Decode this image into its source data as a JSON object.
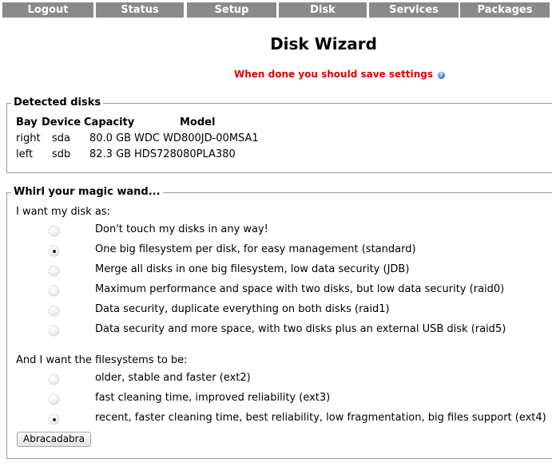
{
  "nav": {
    "items": [
      {
        "label": "Logout"
      },
      {
        "label": "Status"
      },
      {
        "label": "Setup"
      },
      {
        "label": "Disk"
      },
      {
        "label": "Services"
      },
      {
        "label": "Packages"
      }
    ],
    "bg_color": "#8a8a8a"
  },
  "page": {
    "title": "Disk Wizard",
    "save_note": "When done you should save settings",
    "save_note_color": "#e00000",
    "help_icon": "help-icon"
  },
  "detected": {
    "legend": "Detected disks",
    "headers": {
      "bay": "Bay",
      "device": "Device",
      "capacity": "Capacity",
      "model": "Model"
    },
    "rows": [
      {
        "bay": "right",
        "device": "sda",
        "capacity": "80.0 GB",
        "model": "WDC WD800JD-00MSA1"
      },
      {
        "bay": "left",
        "device": "sdb",
        "capacity": "82.3 GB",
        "model": "HDS728080PLA380"
      }
    ]
  },
  "wizard": {
    "legend": "Whirl your magic wand...",
    "disk_prompt": "I want my disk as:",
    "disk_options": [
      {
        "label": "Don't touch my disks in any way!",
        "checked": false
      },
      {
        "label": "One big filesystem per disk, for easy management (standard)",
        "checked": true
      },
      {
        "label": "Merge all disks in one big filesystem, low data security (JDB)",
        "checked": false
      },
      {
        "label": "Maximum performance and space with two disks, but low data security (raid0)",
        "checked": false
      },
      {
        "label": "Data security, duplicate everything on both disks (raid1)",
        "checked": false
      },
      {
        "label": "Data security and more space, with two disks plus an external USB disk (raid5)",
        "checked": false
      }
    ],
    "fs_prompt": "And I want the filesystems to be:",
    "fs_options": [
      {
        "label": "older, stable and faster (ext2)",
        "checked": false
      },
      {
        "label": "fast cleaning time, improved reliability (ext3)",
        "checked": false
      },
      {
        "label": "recent, faster cleaning time, best reliability, low fragmentation, big files support (ext4)",
        "checked": true
      }
    ],
    "submit_label": "Abracadabra"
  }
}
